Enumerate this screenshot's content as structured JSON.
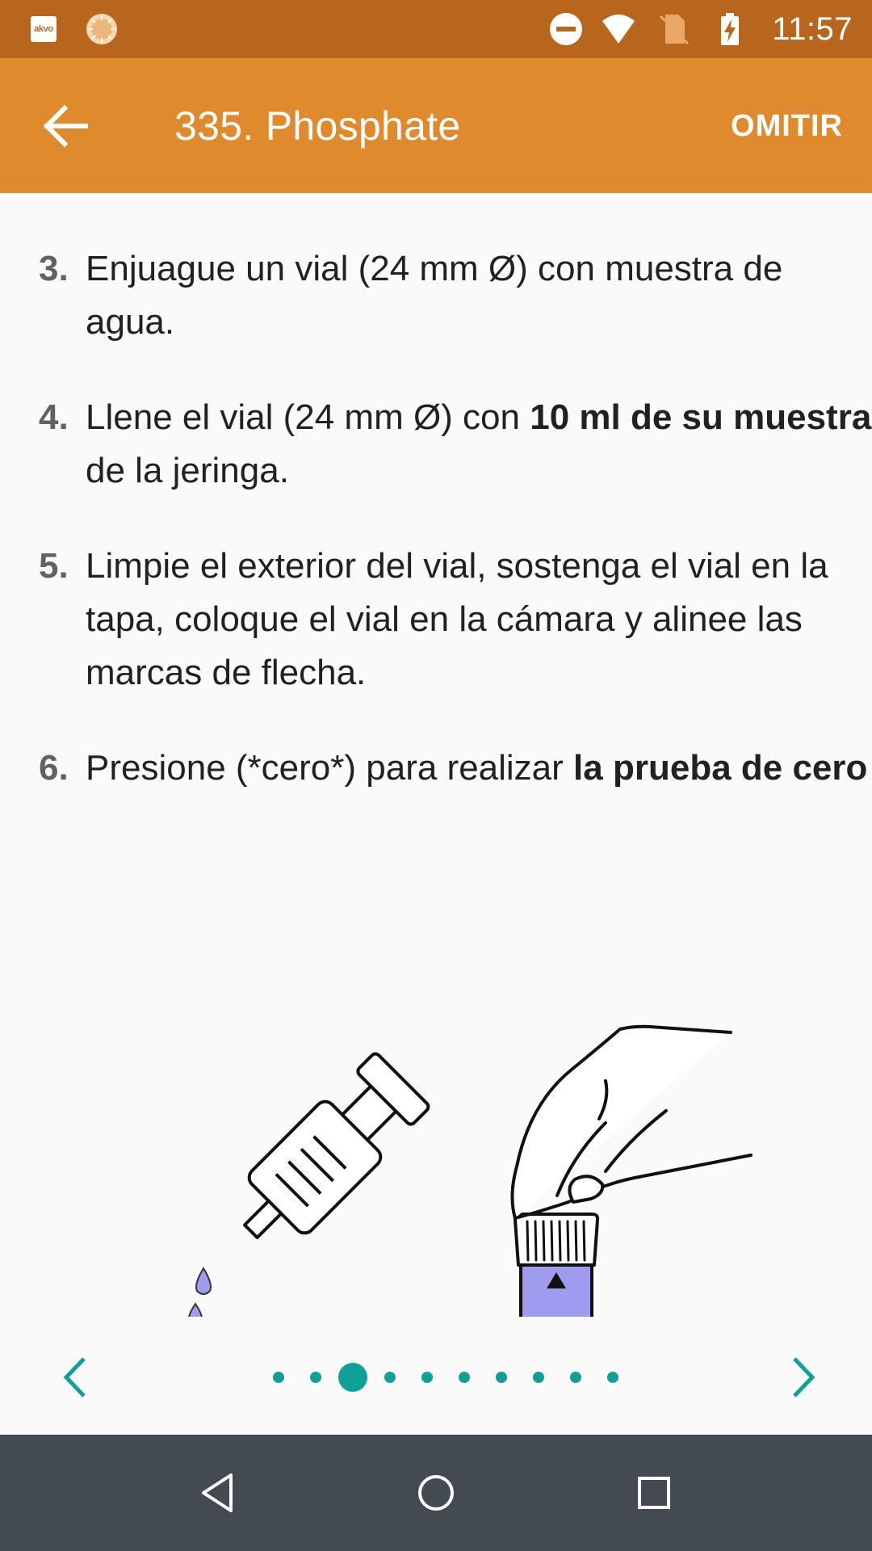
{
  "status_bar": {
    "app_icon_text": "akvo",
    "time": "11:57",
    "icons": [
      "akvo-app-icon",
      "sun-icon",
      "do-not-disturb-icon",
      "wifi-icon",
      "no-sim-icon",
      "battery-charging-icon"
    ]
  },
  "app_bar": {
    "back_icon": "arrow-left-icon",
    "title": "335. Phosphate",
    "skip_label": "OMITIR",
    "color": "#df8a2c",
    "status_color": "#b8651e"
  },
  "steps": [
    {
      "number": "3.",
      "segments": [
        {
          "text": "Enjuague un vial (24 mm Ø) con muestra de agua.",
          "bold": false
        }
      ]
    },
    {
      "number": "4.",
      "segments": [
        {
          "text": "Llene el vial (24 mm Ø) con ",
          "bold": false
        },
        {
          "text": "10 ml de su muestra",
          "bold": true
        },
        {
          "text": " de la jeringa.",
          "bold": false
        }
      ]
    },
    {
      "number": "5.",
      "segments": [
        {
          "text": "Limpie el exterior del vial, sostenga el vial en la tapa, coloque el vial en la cámara y alinee las marcas de flecha.",
          "bold": false
        }
      ]
    },
    {
      "number": "6.",
      "segments": [
        {
          "text": "Presione (*cero*) para realizar ",
          "bold": false
        },
        {
          "text": "la prueba de cero",
          "bold": true
        }
      ]
    }
  ],
  "illustration": {
    "items": [
      "syringe-icon",
      "hand-holding-vial-icon"
    ],
    "liquid_color": "#9f9cf0"
  },
  "pager": {
    "prev_icon": "chevron-left-icon",
    "next_icon": "chevron-right-icon",
    "page_count": 10,
    "current_page": 3,
    "accent_color": "#0fa198"
  },
  "nav_bar": {
    "icons": [
      "back-triangle-icon",
      "home-circle-icon",
      "recents-square-icon"
    ],
    "color": "#444a51"
  }
}
